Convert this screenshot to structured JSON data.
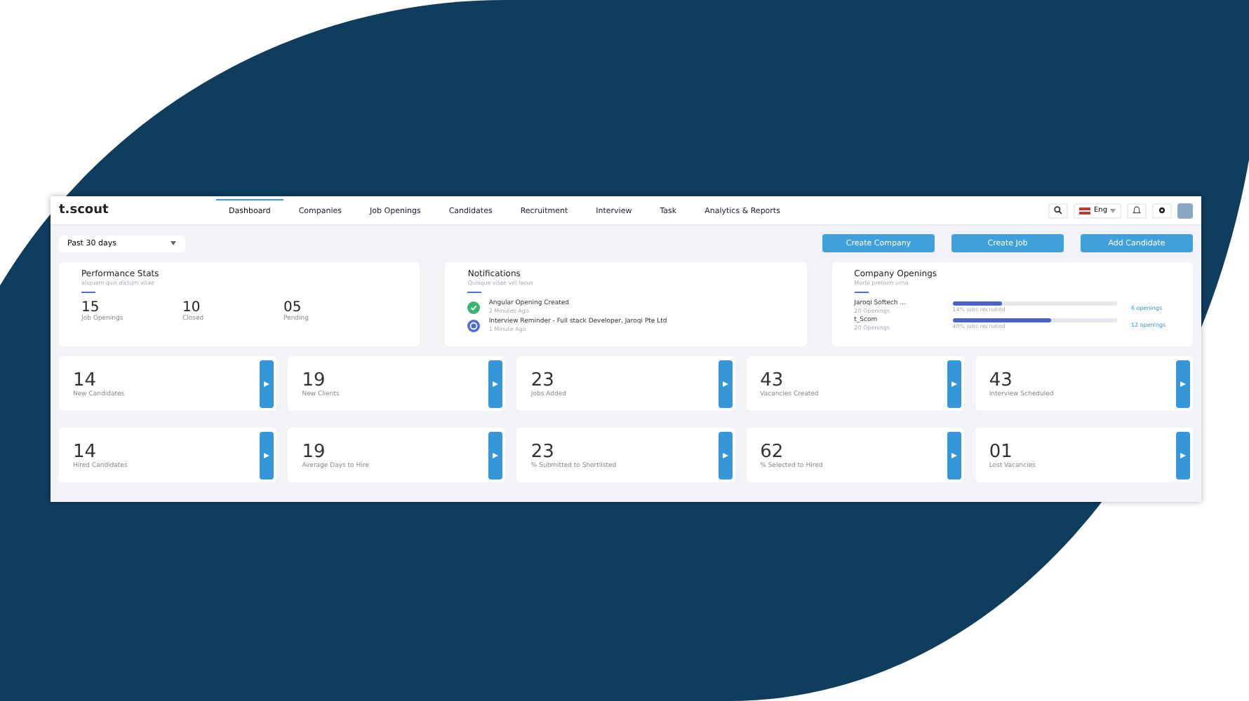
{
  "app": {
    "logo": "t.scout"
  },
  "nav": [
    {
      "label": "Dashboard",
      "selected": true
    },
    {
      "label": "Companies",
      "selected": false
    },
    {
      "label": "Job Openings",
      "selected": false
    },
    {
      "label": "Candidates",
      "selected": false
    },
    {
      "label": "Recruitment",
      "selected": false
    },
    {
      "label": "Interview",
      "selected": false
    },
    {
      "label": "Task",
      "selected": false
    },
    {
      "label": "Analytics & Reports",
      "selected": false
    }
  ],
  "language": {
    "label": "Eng"
  },
  "period": {
    "value": "Past 30 days"
  },
  "actions": [
    "Create Company",
    "Create Job",
    "Add Candidate"
  ],
  "performance": {
    "title": "Performance Stats",
    "subtitle": "aliquam quis dictum vitae",
    "stats": [
      {
        "value": "15",
        "label": "Job Openings"
      },
      {
        "value": "10",
        "label": "Closed"
      },
      {
        "value": "05",
        "label": "Pending"
      }
    ]
  },
  "notifications": {
    "title": "Notifications",
    "subtitle": "Quisque vitae vel lacus",
    "items": [
      {
        "kind": "done",
        "text": "Angular Opening Created",
        "time": "2 Minutes Ago"
      },
      {
        "kind": "reminder",
        "text": "Interview Reminder - Full stack Developer, Jaroqi Pte Ltd",
        "time": "1 Minute Ago"
      }
    ]
  },
  "company_openings": {
    "title": "Company Openings",
    "subtitle": "Morbi pretium urna",
    "items": [
      {
        "name": "Jaroqi Softech ...",
        "sub": "20 Openings",
        "level": 0.3,
        "note": "14% jobs recruited",
        "count": "6 openings"
      },
      {
        "name": "t_Scom",
        "sub": "20 Openings",
        "level": 0.6,
        "note": "40% jobs recruited",
        "count": "12 openings"
      }
    ]
  },
  "stats_row_1": [
    {
      "value": "14",
      "label": "New Candidates"
    },
    {
      "value": "19",
      "label": "New Clients"
    },
    {
      "value": "23",
      "label": "Jobs Added"
    },
    {
      "value": "43",
      "label": "Vacancies Created"
    },
    {
      "value": "43",
      "label": "Interview Scheduled"
    }
  ],
  "stats_row_2": [
    {
      "value": "14",
      "label": "Hired Candidates"
    },
    {
      "value": "19",
      "label": "Average Days to Hire"
    },
    {
      "value": "23",
      "label": "% Submitted to Shortlisted"
    },
    {
      "value": "62",
      "label": "% Selected to Hired"
    },
    {
      "value": "01",
      "label": "Lost Vacancies"
    }
  ]
}
